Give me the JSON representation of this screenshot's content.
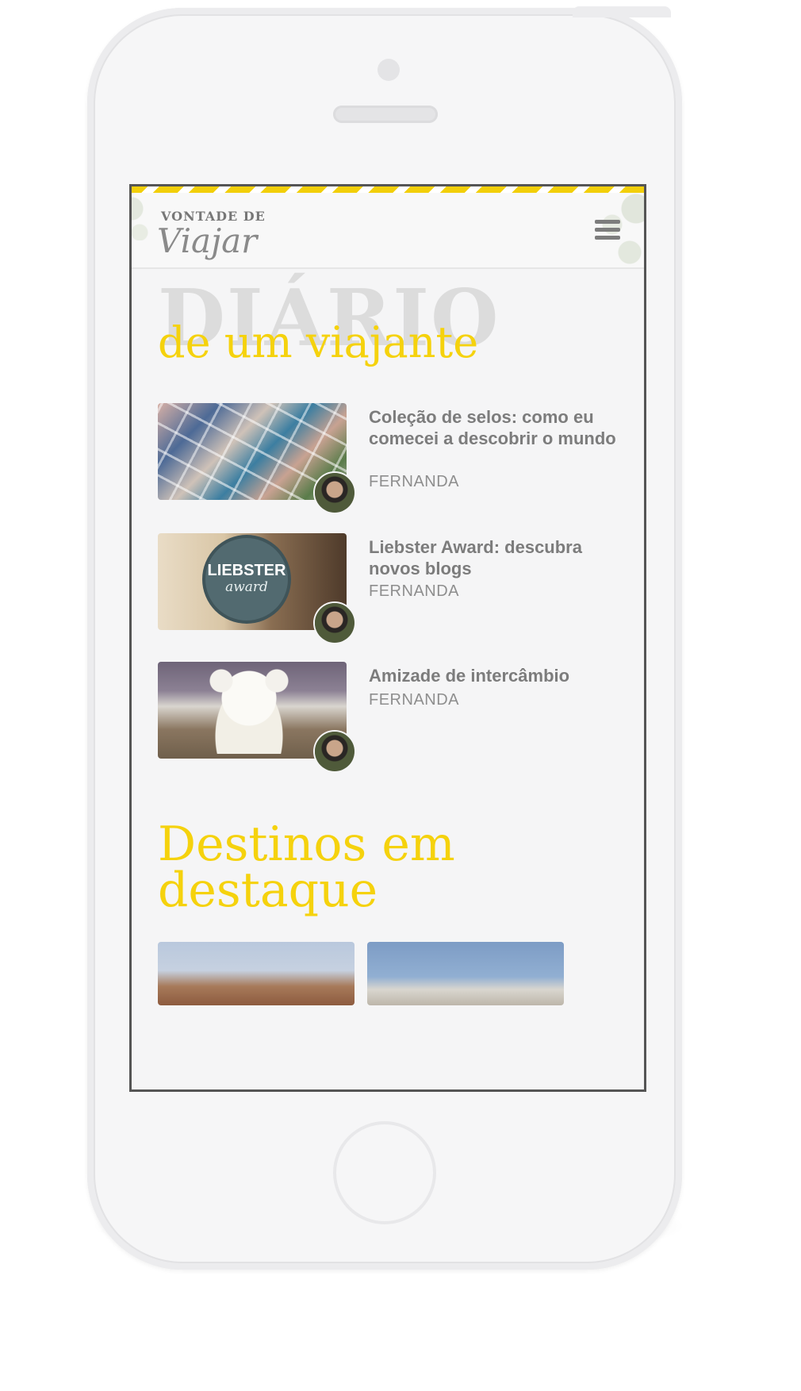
{
  "header": {
    "logo_top": "VONTADE DE",
    "logo_main": "Viajar",
    "menu_icon": "hamburger-menu-icon"
  },
  "diary": {
    "heading_bg": "DIÁRIO",
    "heading": "de um viajante",
    "posts": [
      {
        "title": "Coleção de selos: como eu comecei a descobrir o mundo",
        "author": "FERNANDA"
      },
      {
        "title": "Liebster Award: descubra novos blogs",
        "author": "FERNANDA",
        "badge_main": "LIEBSTER",
        "badge_sub": "award"
      },
      {
        "title": "Amizade de intercâmbio",
        "author": "FERNANDA"
      }
    ]
  },
  "featured": {
    "heading": "Destinos em destaque"
  },
  "colors": {
    "accent_yellow": "#f5d20d",
    "text_gray": "#7c7c7c",
    "screen_bg": "#f5f5f6"
  }
}
